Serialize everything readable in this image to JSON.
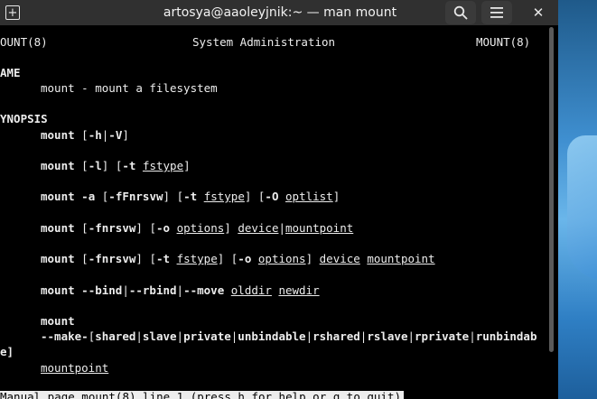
{
  "window": {
    "title": "artosya@aaoleyjnik:~ — man mount",
    "new_tab_icon": "+",
    "close_icon": "✕"
  },
  "man": {
    "header_left": "OUNT(8)",
    "header_center": "System Administration",
    "header_right": "MOUNT(8)",
    "name_heading": "AME",
    "name_desc": "mount - mount a filesystem",
    "synopsis_heading": "YNOPSIS",
    "l1": {
      "a": "mount",
      "b": " [",
      "c": "-h",
      "d": "|",
      "e": "-V",
      "f": "]"
    },
    "l2": {
      "a": "mount",
      "b": " [",
      "c": "-l",
      "d": "] [",
      "e": "-t",
      "f": " ",
      "g": "fstype",
      "h": "]"
    },
    "l3": {
      "a": "mount",
      "b": " ",
      "c": "-a",
      "d": " [",
      "e": "-fFnrsvw",
      "f": "] [",
      "g": "-t",
      "h": " ",
      "i": "fstype",
      "j": "] [",
      "k": "-O",
      "l": " ",
      "m": "optlist",
      "n": "]"
    },
    "l4": {
      "a": "mount",
      "b": " [",
      "c": "-fnrsvw",
      "d": "] [",
      "e": "-o",
      "f": " ",
      "g": "options",
      "h": "] ",
      "i": "device",
      "j": "|",
      "k": "mountpoint"
    },
    "l5": {
      "a": "mount",
      "b": " [",
      "c": "-fnrsvw",
      "d": "] [",
      "e": "-t",
      "f": " ",
      "g": "fstype",
      "h": "] [",
      "i": "-o",
      "j": " ",
      "k": "options",
      "l": "] ",
      "m": "device",
      "n": " ",
      "o": "mountpoint"
    },
    "l6": {
      "a": "mount",
      "b": " ",
      "c": "--bind",
      "d": "|",
      "e": "--rbind",
      "f": "|",
      "g": "--move",
      "h": " ",
      "i": "olddir",
      "j": " ",
      "k": "newdir"
    },
    "l7": "mount",
    "l8": {
      "a": "--make-",
      "b": "[",
      "c": "shared",
      "d": "|",
      "e": "slave",
      "f": "|",
      "g": "private",
      "h": "|",
      "i": "unbindable",
      "j": "|",
      "k": "rshared",
      "l": "|",
      "m": "rslave",
      "n": "|",
      "o": "rprivate",
      "p": "|",
      "q": "runbindab"
    },
    "l8_wrap": "e]",
    "l9": "mountpoint",
    "status": "Manual page mount(8) line 1 (press h for help or q to quit)"
  }
}
